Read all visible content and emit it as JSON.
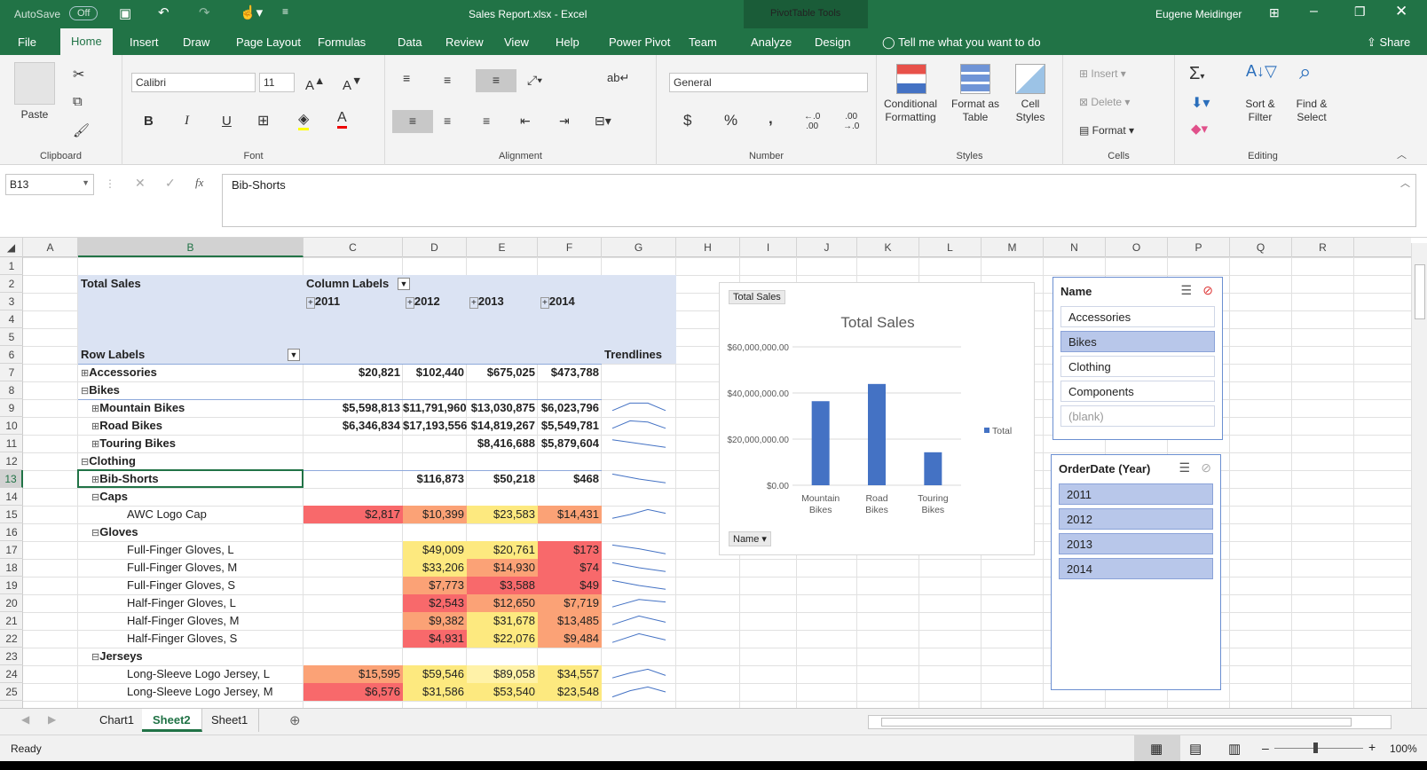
{
  "title_bar": {
    "autosave": "AutoSave",
    "autosave_state": "Off",
    "doc_title": "Sales Report.xlsx  -  Excel",
    "pivot_tools": "PivotTable Tools",
    "user": "Eugene Meidinger"
  },
  "tabs": [
    "File",
    "Home",
    "Insert",
    "Draw",
    "Page Layout",
    "Formulas",
    "Data",
    "Review",
    "View",
    "Help",
    "Power Pivot",
    "Team",
    "Analyze",
    "Design"
  ],
  "active_tab": "Home",
  "tell_me": "Tell me what you want to do",
  "share": "Share",
  "ribbon": {
    "clipboard": {
      "label": "Clipboard",
      "paste": "Paste"
    },
    "font": {
      "label": "Font",
      "name": "Calibri",
      "size": "11",
      "bold": "B",
      "italic": "I",
      "underline": "U"
    },
    "alignment": {
      "label": "Alignment"
    },
    "number": {
      "label": "Number",
      "format": "General",
      "currency": "$",
      "percent": "%",
      "comma": ","
    },
    "styles": {
      "label": "Styles",
      "conditional": "Conditional Formatting",
      "format_table": "Format as Table",
      "cell_styles": "Cell Styles"
    },
    "cells": {
      "label": "Cells",
      "insert": "Insert",
      "delete": "Delete",
      "format": "Format"
    },
    "editing": {
      "label": "Editing",
      "sort": "Sort & Filter",
      "find": "Find & Select"
    }
  },
  "formula_bar": {
    "cell_ref": "B13",
    "content": "Bib-Shorts"
  },
  "columns": [
    "A",
    "B",
    "C",
    "D",
    "E",
    "F",
    "G",
    "H",
    "I",
    "J",
    "K",
    "L",
    "M",
    "N",
    "O",
    "P",
    "Q",
    "R"
  ],
  "rows": [
    "1",
    "2",
    "3",
    "4",
    "5",
    "6",
    "7",
    "8",
    "9",
    "10",
    "11",
    "12",
    "13",
    "14",
    "15",
    "16",
    "17",
    "18",
    "19",
    "20",
    "21",
    "22",
    "23",
    "24",
    "25"
  ],
  "pivot": {
    "total_sales": "Total Sales",
    "column_labels": "Column Labels",
    "row_labels": "Row Labels",
    "trendlines": "Trendlines",
    "years": [
      "2011",
      "2012",
      "2013",
      "2014"
    ],
    "rows": [
      {
        "label": "Accessories",
        "level": 0,
        "sign": "+",
        "values": [
          "$20,821",
          "$102,440",
          "$675,025",
          "$473,788"
        ]
      },
      {
        "label": "Bikes",
        "level": 0,
        "sign": "-",
        "values": [
          "",
          "",
          "",
          ""
        ]
      },
      {
        "label": "Mountain Bikes",
        "level": 1,
        "sign": "+",
        "values": [
          "$5,598,813",
          "$11,791,960",
          "$13,030,875",
          "$6,023,796"
        ]
      },
      {
        "label": "Road Bikes",
        "level": 1,
        "sign": "+",
        "values": [
          "$6,346,834",
          "$17,193,556",
          "$14,819,267",
          "$5,549,781"
        ]
      },
      {
        "label": "Touring Bikes",
        "level": 1,
        "sign": "+",
        "values": [
          "",
          "",
          "$8,416,688",
          "$5,879,604"
        ]
      },
      {
        "label": "Clothing",
        "level": 0,
        "sign": "-",
        "values": [
          "",
          "",
          "",
          ""
        ]
      },
      {
        "label": "Bib-Shorts",
        "level": 1,
        "sign": "+",
        "values": [
          "",
          "$116,873",
          "$50,218",
          "$468"
        ]
      },
      {
        "label": "Caps",
        "level": 1,
        "sign": "-",
        "values": [
          "",
          "",
          "",
          ""
        ]
      },
      {
        "label": "AWC Logo Cap",
        "level": 2,
        "sign": "",
        "values": [
          "$2,817",
          "$10,399",
          "$23,583",
          "$14,431"
        ]
      },
      {
        "label": "Gloves",
        "level": 1,
        "sign": "-",
        "values": [
          "",
          "",
          "",
          ""
        ]
      },
      {
        "label": "Full-Finger Gloves, L",
        "level": 2,
        "sign": "",
        "values": [
          "",
          "$49,009",
          "$20,761",
          "$173"
        ]
      },
      {
        "label": "Full-Finger Gloves, M",
        "level": 2,
        "sign": "",
        "values": [
          "",
          "$33,206",
          "$14,930",
          "$74"
        ]
      },
      {
        "label": "Full-Finger Gloves, S",
        "level": 2,
        "sign": "",
        "values": [
          "",
          "$7,773",
          "$3,588",
          "$49"
        ]
      },
      {
        "label": "Half-Finger Gloves, L",
        "level": 2,
        "sign": "",
        "values": [
          "",
          "$2,543",
          "$12,650",
          "$7,719"
        ]
      },
      {
        "label": "Half-Finger Gloves, M",
        "level": 2,
        "sign": "",
        "values": [
          "",
          "$9,382",
          "$31,678",
          "$13,485"
        ]
      },
      {
        "label": "Half-Finger Gloves, S",
        "level": 2,
        "sign": "",
        "values": [
          "",
          "$4,931",
          "$22,076",
          "$9,484"
        ]
      },
      {
        "label": "Jerseys",
        "level": 1,
        "sign": "-",
        "values": [
          "",
          "",
          "",
          ""
        ]
      },
      {
        "label": "Long-Sleeve Logo Jersey, L",
        "level": 2,
        "sign": "",
        "values": [
          "$15,595",
          "$59,546",
          "$89,058",
          "$34,557"
        ]
      },
      {
        "label": "Long-Sleeve Logo Jersey, M",
        "level": 2,
        "sign": "",
        "values": [
          "$6,576",
          "$31,586",
          "$53,540",
          "$23,548"
        ]
      }
    ],
    "colors": {
      "header_bg": "#dbe3f3",
      "red": "#f8696b",
      "orange": "#fba276",
      "yellow": "#fde97f",
      "lightyellow": "#fff2a8"
    }
  },
  "chart": {
    "title": "Total Sales",
    "tag": "Total Sales",
    "legend": "Total",
    "filter_button": "Name",
    "chart_data": {
      "type": "bar",
      "categories": [
        "Mountain Bikes",
        "Road Bikes",
        "Touring Bikes"
      ],
      "series": [
        {
          "name": "Total",
          "values": [
            36445444,
            43909438,
            14296292
          ]
        }
      ],
      "ylim": [
        0,
        60000000
      ],
      "yticks": [
        "$0.00",
        "$20,000,000.00",
        "$40,000,000.00",
        "$60,000,000.00"
      ],
      "color": "#4472c4"
    }
  },
  "slicer_name": {
    "header": "Name",
    "items": [
      "Accessories",
      "Bikes",
      "Clothing",
      "Components",
      "(blank)"
    ],
    "selected": [
      "Bikes"
    ]
  },
  "slicer_year": {
    "header": "OrderDate (Year)",
    "items": [
      "2011",
      "2012",
      "2013",
      "2014"
    ],
    "selected": [
      "2011",
      "2012",
      "2013",
      "2014"
    ]
  },
  "sheets": [
    "Chart1",
    "Sheet2",
    "Sheet1"
  ],
  "active_sheet": "Sheet2",
  "status": {
    "ready": "Ready",
    "zoom": "100%"
  }
}
